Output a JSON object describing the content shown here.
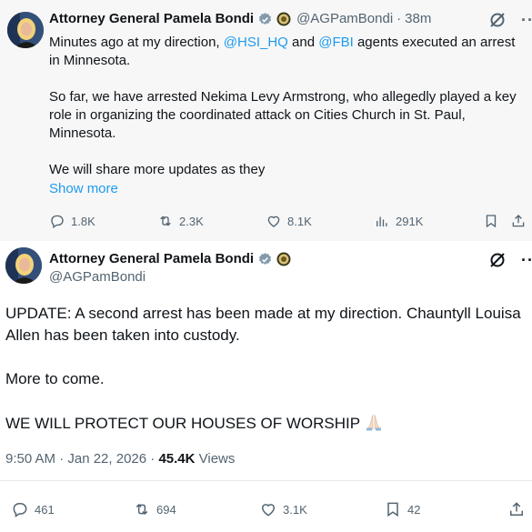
{
  "tweet1": {
    "author_name": "Attorney General Pamela Bondi",
    "handle": "@AGPamBondi",
    "separator": "·",
    "time": "38m",
    "text_line1_pre": "Minutes ago at my direction, ",
    "mention1": "@HSI_HQ",
    "text_and": " and ",
    "mention2": "@FBI",
    "text_line1_post": " agents executed an arrest in Minnesota.",
    "paragraph2": "So far, we have arrested Nekima Levy Armstrong, who allegedly played a key role in organizing the coordinated attack on Cities Church in St. Paul, Minnesota.",
    "paragraph3": "We will share more updates as they",
    "show_more": "Show more",
    "replies": "1.8K",
    "reposts": "2.3K",
    "likes": "8.1K",
    "views": "291K"
  },
  "tweet2": {
    "author_name": "Attorney General Pamela Bondi",
    "handle": "@AGPamBondi",
    "paragraph1": "UPDATE: A second arrest has been made at my direction. Chauntyll Louisa Allen has been taken into custody.",
    "paragraph2": "More to come.",
    "paragraph3": "WE WILL PROTECT OUR HOUSES OF WORSHIP",
    "timestamp": "9:50 AM · Jan 22, 2026 · ",
    "views_count": "45.4K",
    "views_label": " Views",
    "replies": "461",
    "reposts": "694",
    "likes": "3.1K",
    "bookmarks": "42"
  },
  "colors": {
    "link": "#1d9bf0",
    "muted": "#536471",
    "verified": "#829aab",
    "tweet1_bg": "#f7f7f7"
  },
  "icons": [
    "verified-badge-icon",
    "government-seal-icon",
    "grok-icon",
    "more-icon",
    "reply-icon",
    "repost-icon",
    "like-icon",
    "views-icon",
    "bookmark-icon",
    "share-icon",
    "folded-hands-icon"
  ]
}
